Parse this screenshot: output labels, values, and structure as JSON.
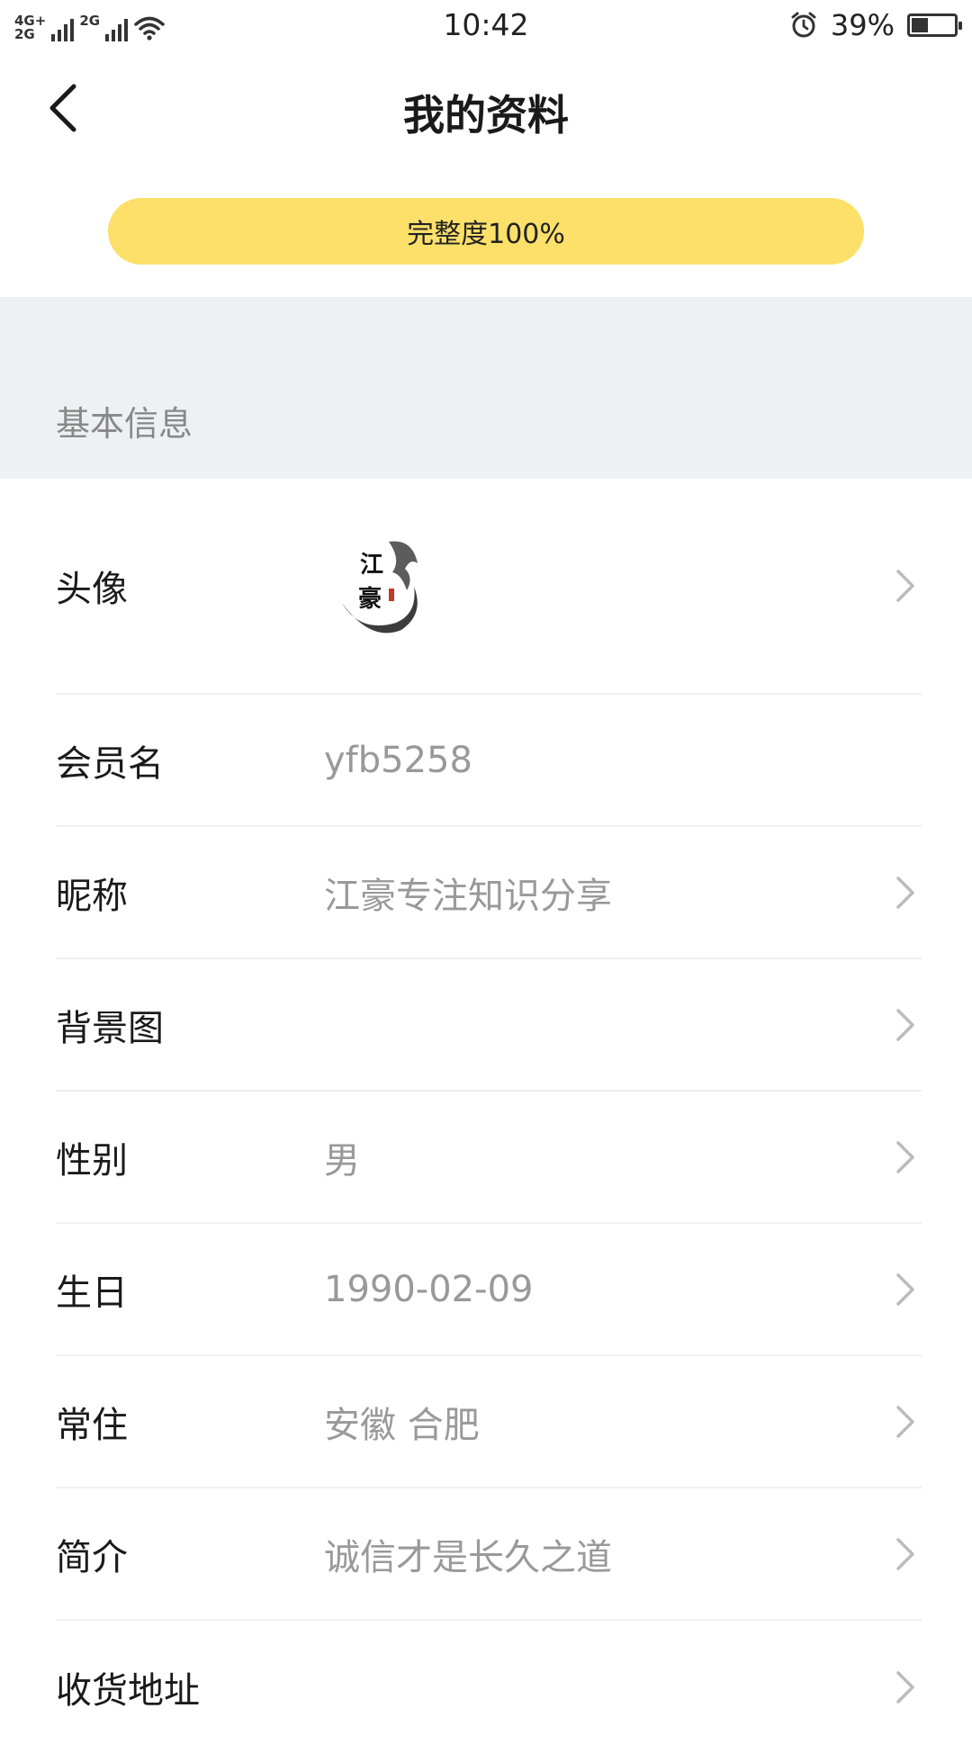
{
  "status_bar": {
    "network_top": "4G+",
    "network_bottom": "2G",
    "network_2": "2G",
    "time": "10:42",
    "battery_percent": "39%",
    "battery_level": 0.39,
    "icons": [
      "signal-icon",
      "wifi-icon",
      "alarm-icon",
      "battery-icon"
    ]
  },
  "header": {
    "title": "我的资料",
    "back_icon": "chevron-left-icon"
  },
  "completeness": {
    "label": "完整度100%",
    "value": 1.0,
    "color": "#fde06a"
  },
  "section": {
    "title": "基本信息"
  },
  "rows": [
    {
      "label": "头像",
      "value": "",
      "type": "avatar",
      "avatar_text_1": "江",
      "avatar_text_2": "豪",
      "chevron": true
    },
    {
      "label": "会员名",
      "value": "yfb5258",
      "chevron": false
    },
    {
      "label": "昵称",
      "value": "江豪专注知识分享",
      "chevron": true
    },
    {
      "label": "背景图",
      "value": "",
      "chevron": true
    },
    {
      "label": "性别",
      "value": "男",
      "chevron": true
    },
    {
      "label": "生日",
      "value": "1990-02-09",
      "chevron": true
    },
    {
      "label": "常住",
      "value": "安徽 合肥",
      "chevron": true
    },
    {
      "label": "简介",
      "value": "诚信才是长久之道",
      "chevron": true
    },
    {
      "label": "收货地址",
      "value": "",
      "chevron": true
    }
  ]
}
